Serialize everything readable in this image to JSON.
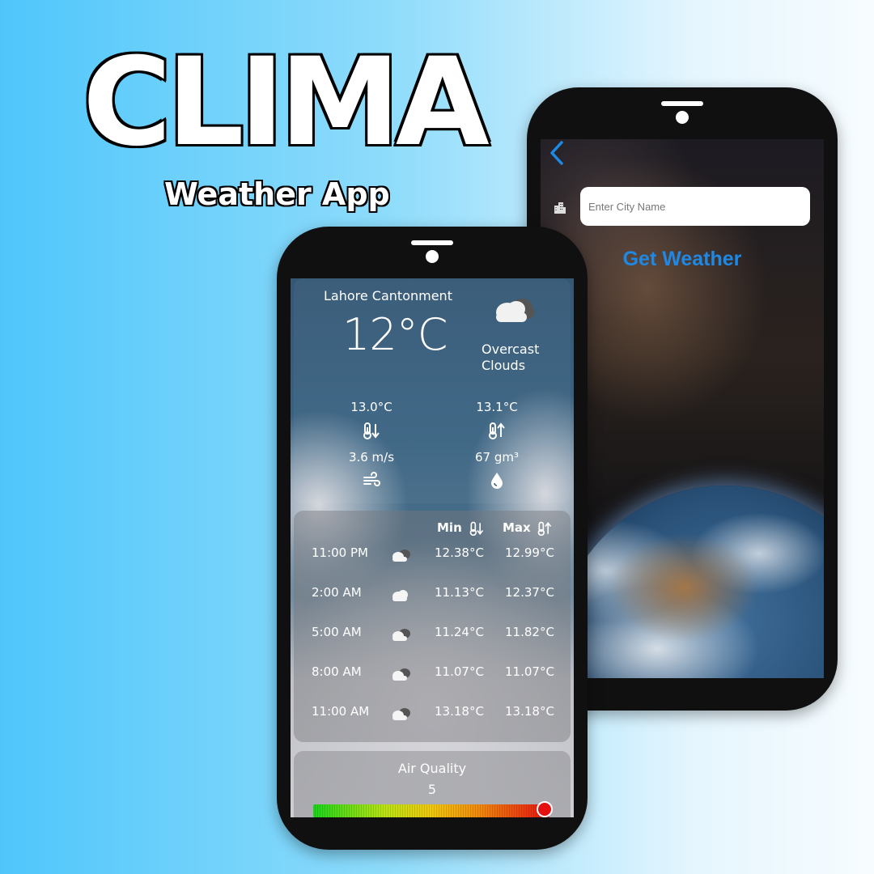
{
  "branding": {
    "title": "CLIMA",
    "subtitle": "Weather App"
  },
  "search_screen": {
    "input_placeholder": "Enter City Name",
    "button_label": "Get Weather",
    "accent_color": "#1e88e5"
  },
  "weather_screen": {
    "location": "Lahore Cantonment",
    "temperature": "12°C",
    "condition": "Overcast Clouds",
    "stats": {
      "min_temp": "13.0°C",
      "max_temp": "13.1°C",
      "wind_speed": "3.6 m/s",
      "humidity": "67 gm³"
    },
    "forecast": {
      "min_header": "Min",
      "max_header": "Max",
      "rows": [
        {
          "time": "11:00 PM",
          "min": "12.38°C",
          "max": "12.99°C"
        },
        {
          "time": "2:00 AM",
          "min": "11.13°C",
          "max": "12.37°C"
        },
        {
          "time": "5:00 AM",
          "min": "11.24°C",
          "max": "11.82°C"
        },
        {
          "time": "8:00 AM",
          "min": "11.07°C",
          "max": "11.07°C"
        },
        {
          "time": "11:00 AM",
          "min": "13.18°C",
          "max": "13.18°C"
        }
      ]
    },
    "air_quality": {
      "label": "Air Quality",
      "value": "5",
      "scale_max": 5
    }
  },
  "icons": {
    "back": "chevron-left-icon",
    "city": "city-buildings-icon",
    "cloud": "cloud-icon",
    "thermometer_down": "thermometer-down-icon",
    "thermometer_up": "thermometer-up-icon",
    "wind": "wind-icon",
    "humidity": "water-drop-icon"
  }
}
